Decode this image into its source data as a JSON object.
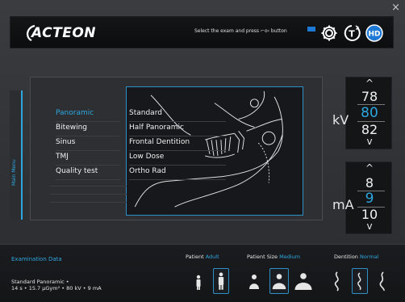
{
  "window": {
    "close_glyph": "×"
  },
  "header": {
    "logo_text": "ACTEON",
    "hint_text": "Select the exam and press ⌐o‹ button",
    "hint_color": "#1e79d6",
    "icons": [
      "settings-gear-icon",
      "t-timer-icon",
      "hd-icon"
    ],
    "hd_label": "HD",
    "t_label": "T",
    "accent": "#2ea7e0"
  },
  "side_tab": {
    "label": "Main Menu"
  },
  "exams": [
    "Panoramic",
    "Bitewing",
    "Sinus",
    "TMJ",
    "Quality test"
  ],
  "selected_exam": "Panoramic",
  "presets": [
    "Standard",
    "Half Panoramic",
    "Frontal Dentition",
    "Low Dose",
    "Ortho Rad"
  ],
  "kv": {
    "unit": "kV",
    "prev": "78",
    "current": "80",
    "next": "82",
    "up": "^",
    "down": "v"
  },
  "ma": {
    "unit": "mA",
    "prev": "8",
    "current": "9",
    "next": "10",
    "up": "^",
    "down": "v"
  },
  "bottom": {
    "exam_data_title": "Examination Data",
    "exam_data_line1": "Standard Panoramic •",
    "exam_data_line2": "14 s • 15.7 µGym² • 80 kV • 9 mA",
    "patient_label": "Patient",
    "patient_value": "Adult",
    "size_label": "Patient  Size",
    "size_value": "Medium",
    "dentition_label": "Dentition",
    "dentition_value": "Normal"
  }
}
